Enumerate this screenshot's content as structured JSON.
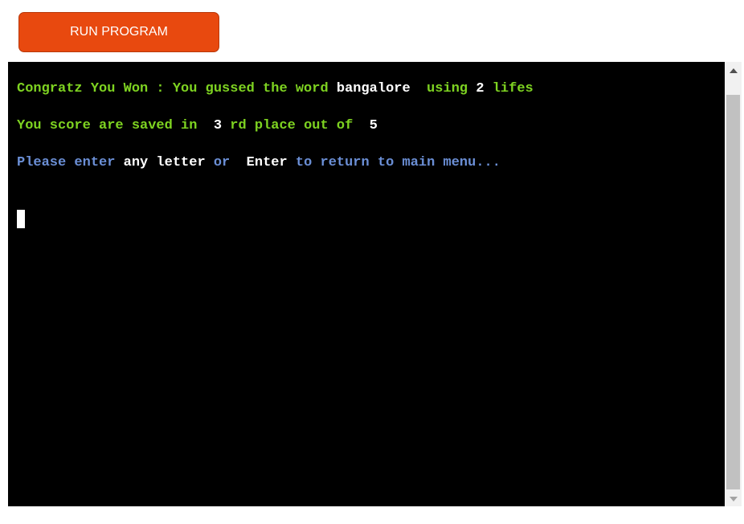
{
  "toolbar": {
    "run_label": "RUN PROGRAM"
  },
  "terminal": {
    "line1": {
      "congrats_text": "Congratz You Won : You gussed the word",
      "word": "bangalore",
      "using_text": "using",
      "lives_count": "2",
      "lives_text": "lifes"
    },
    "line2": {
      "score_text": "You score are saved in",
      "place_number": "3",
      "place_text": "rd place out of",
      "total": "5"
    },
    "line3": {
      "please_text": "Please enter",
      "any_letter": "any letter",
      "or_text": "or",
      "enter_key": "Enter",
      "return_text": "to return to main menu..."
    }
  },
  "colors": {
    "button_bg": "#e8490f",
    "terminal_bg": "#000000",
    "green_text": "#7ed321",
    "blue_text": "#6b8fd6",
    "white_text": "#ffffff"
  }
}
